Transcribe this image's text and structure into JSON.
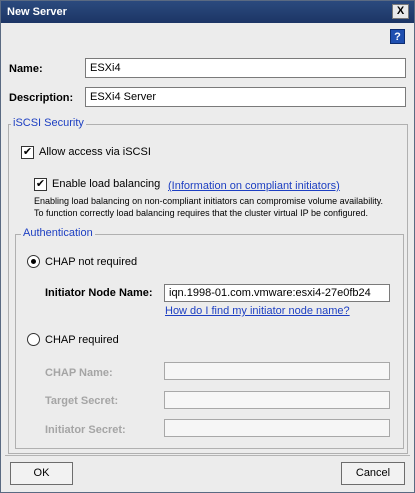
{
  "window": {
    "title": "New Server",
    "close_glyph": "X",
    "help_glyph": "?"
  },
  "fields": {
    "name_label": "Name:",
    "name_value": "ESXi4",
    "description_label": "Description:",
    "description_value": "ESXi4 Server"
  },
  "iscsi": {
    "group_title": "iSCSI Security",
    "allow_label": "Allow access via iSCSI",
    "allow_checked": true,
    "load_balancing_label": "Enable load balancing",
    "load_balancing_checked": true,
    "compliant_link": "(Information on compliant initiators)",
    "note_line1": "Enabling load balancing on non-compliant initiators can compromise volume availability.",
    "note_line2": "To function correctly load balancing requires that the cluster virtual IP be configured."
  },
  "auth": {
    "group_title": "Authentication",
    "chap_not_required_label": "CHAP not required",
    "initiator_node_label": "Initiator Node Name:",
    "initiator_node_value": "iqn.1998-01.com.vmware:esxi4-27e0fb24",
    "find_link": "How do I find my initiator node name?",
    "chap_required_label": "CHAP required",
    "chap_name_label": "CHAP Name:",
    "target_secret_label": "Target Secret:",
    "initiator_secret_label": "Initiator Secret:",
    "selected": "chap-not-required"
  },
  "buttons": {
    "ok": "OK",
    "cancel": "Cancel"
  },
  "icons": {
    "check": "✔"
  }
}
